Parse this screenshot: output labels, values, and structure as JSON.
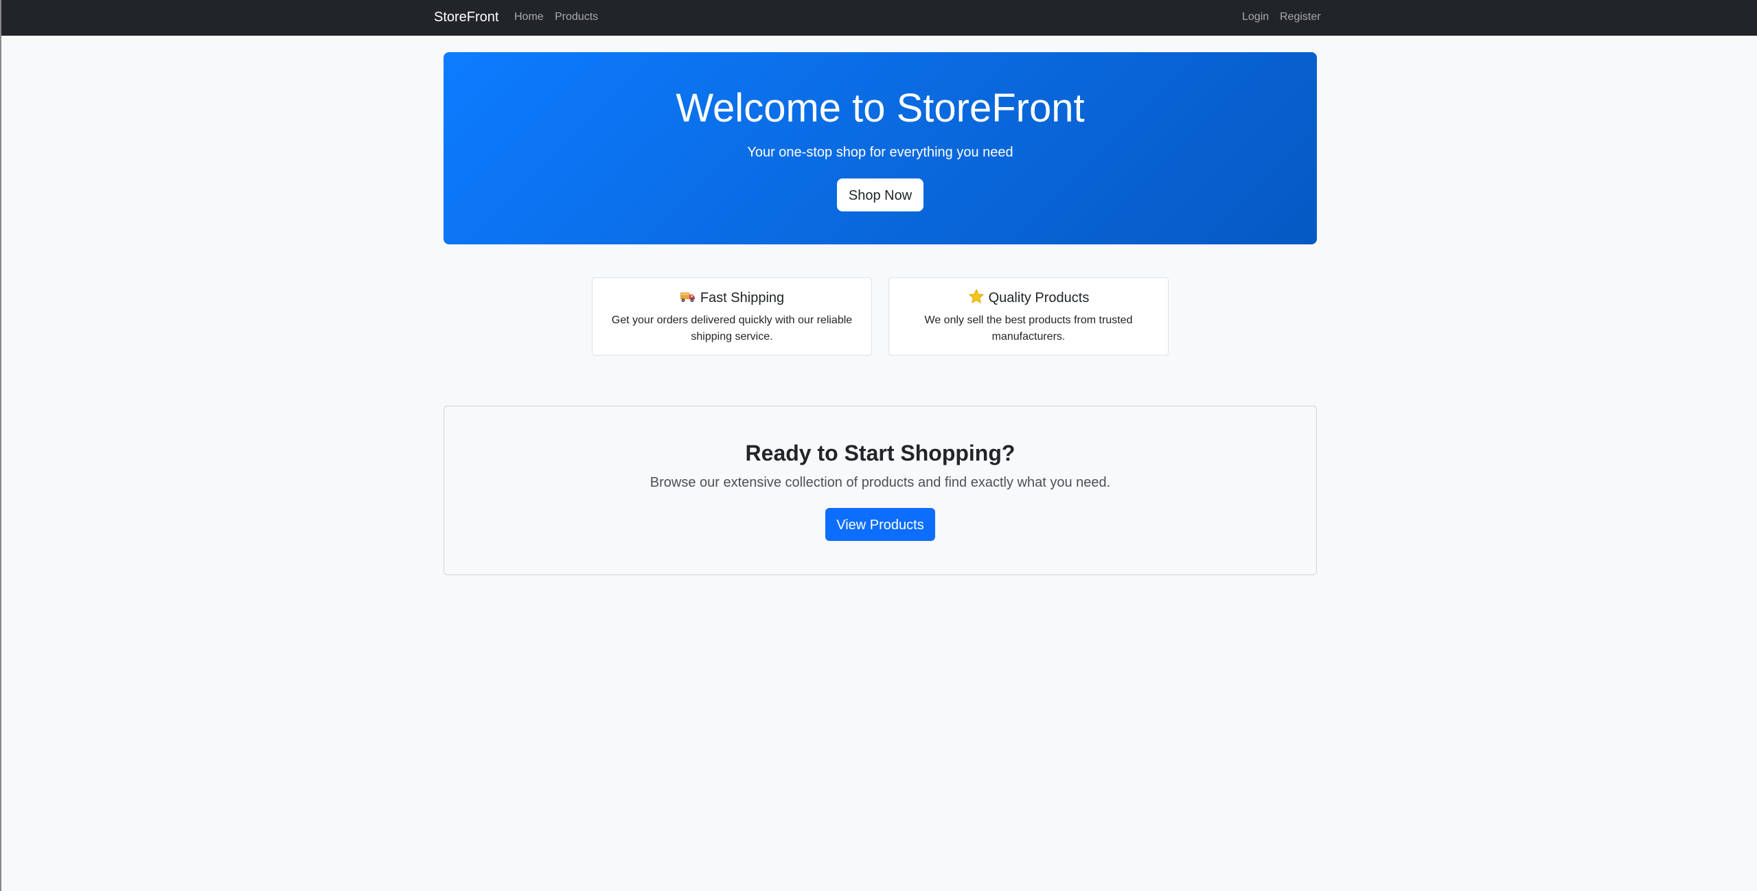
{
  "navbar": {
    "brand": "StoreFront",
    "links": {
      "home": "Home",
      "products": "Products",
      "login": "Login",
      "register": "Register"
    }
  },
  "hero": {
    "title": "Welcome to StoreFront",
    "subtitle": "Your one-stop shop for everything you need",
    "button_label": "Shop Now"
  },
  "features": [
    {
      "icon": "truck-icon",
      "title": "Fast Shipping",
      "text": "Get your orders delivered quickly with our reliable shipping service."
    },
    {
      "icon": "star-icon",
      "title": "Quality Products",
      "text": "We only sell the best products from trusted manufacturers."
    }
  ],
  "cta": {
    "title": "Ready to Start Shopping?",
    "text": "Browse our extensive collection of products and find exactly what you need.",
    "button_label": "View Products"
  },
  "colors": {
    "navbar_bg": "#212529",
    "primary": "#0d6efd",
    "page_bg": "#f8f9fa"
  }
}
